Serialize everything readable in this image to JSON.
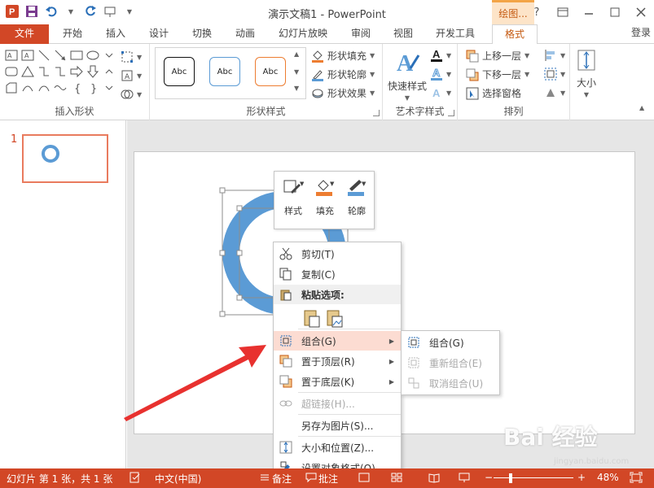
{
  "window": {
    "title": "演示文稿1 - PowerPoint",
    "context_tab_title": "绘图...",
    "buttons": [
      "?",
      "restore",
      "minimize",
      "maximize",
      "close"
    ]
  },
  "ribbon_tabs": [
    {
      "label": "文件"
    },
    {
      "label": "开始"
    },
    {
      "label": "插入"
    },
    {
      "label": "设计"
    },
    {
      "label": "切换"
    },
    {
      "label": "动画"
    },
    {
      "label": "幻灯片放映"
    },
    {
      "label": "审阅"
    },
    {
      "label": "视图"
    },
    {
      "label": "开发工具"
    },
    {
      "label": "格式"
    }
  ],
  "login": "登录",
  "ribbon": {
    "groups": {
      "insert_shapes": "插入形状",
      "shape_styles": "形状样式",
      "wordart_styles": "艺术字样式",
      "arrange": "排列"
    },
    "style_sample": "Abc",
    "shape_fill": "形状填充",
    "shape_outline": "形状轮廓",
    "shape_effects": "形状效果",
    "quick_styles": "快速样式",
    "bring_forward": "上移一层",
    "send_backward": "下移一层",
    "selection_pane": "选择窗格",
    "size": "大小",
    "text_a": "A"
  },
  "thumbnail": {
    "number": "1"
  },
  "mini_toolbar": {
    "style": "样式",
    "fill": "填充",
    "outline": "轮廓"
  },
  "context_menu": {
    "cut": "剪切(T)",
    "copy": "复制(C)",
    "paste_options": "粘贴选项:",
    "group": "组合(G)",
    "bring_to_front": "置于顶层(R)",
    "send_to_back": "置于底层(K)",
    "hyperlink": "超链接(H)...",
    "save_as_picture": "另存为图片(S)...",
    "size_and_position": "大小和位置(Z)...",
    "format_object": "设置对象格式(O)..."
  },
  "group_submenu": {
    "group": "组合(G)",
    "regroup": "重新组合(E)",
    "ungroup": "取消组合(U)"
  },
  "statusbar": {
    "slide_info": "幻灯片 第 1 张，共 1 张",
    "language": "中文(中国)",
    "notes": "备注",
    "comments": "批注",
    "zoom": "48%"
  },
  "watermark": {
    "brand": "Bai 经验",
    "url": "jingyan.baidu.com"
  },
  "colors": {
    "accent": "#d24726",
    "ring": "#5b9bd5",
    "arrow": "#e8312f",
    "menu_highlight": "#fcdcd2"
  }
}
